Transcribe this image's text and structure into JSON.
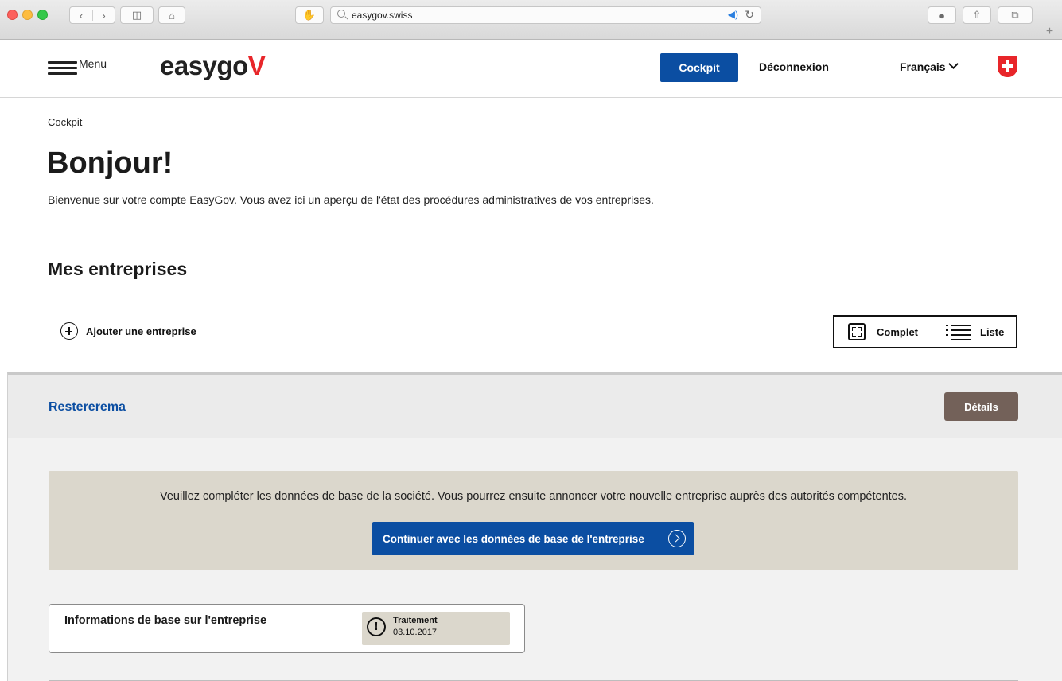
{
  "browser": {
    "url": "easygov.swiss",
    "icons": [
      "back-icon",
      "forward-icon",
      "sidebar-icon",
      "home-icon",
      "extension-icon",
      "search-icon",
      "audio-icon",
      "reload-icon",
      "download-icon",
      "share-icon",
      "tabs-icon",
      "new-tab-icon"
    ]
  },
  "header": {
    "menu_label": "Menu",
    "logo_text": "easygo",
    "logo_accent": "V",
    "cockpit_button": "Cockpit",
    "logout_link": "Déconnexion",
    "language": "Français",
    "colors": {
      "primary": "#0b4ea2",
      "accent": "#e8262a"
    }
  },
  "page": {
    "breadcrumb": "Cockpit",
    "title": "Bonjour!",
    "intro": "Bienvenue sur votre compte EasyGov. Vous avez ici un aperçu de l'état des procédures administratives de vos entreprises."
  },
  "companies": {
    "section_title": "Mes entreprises",
    "add_label": "Ajouter une entreprise",
    "view_options": {
      "full": "Complet",
      "list": "Liste"
    },
    "company": {
      "name": "Restererema",
      "details_button": "Détails",
      "notice_text": "Veuillez compléter les données de base de la société. Vous pourrez ensuite annoncer votre nouvelle entreprise auprès des autorités compétentes.",
      "continue_button": "Continuer avec les données de base de l'entreprise",
      "info_box": {
        "title": "Informations de base sur l'entreprise",
        "status_label": "Traitement",
        "status_date": "03.10.2017"
      }
    }
  }
}
